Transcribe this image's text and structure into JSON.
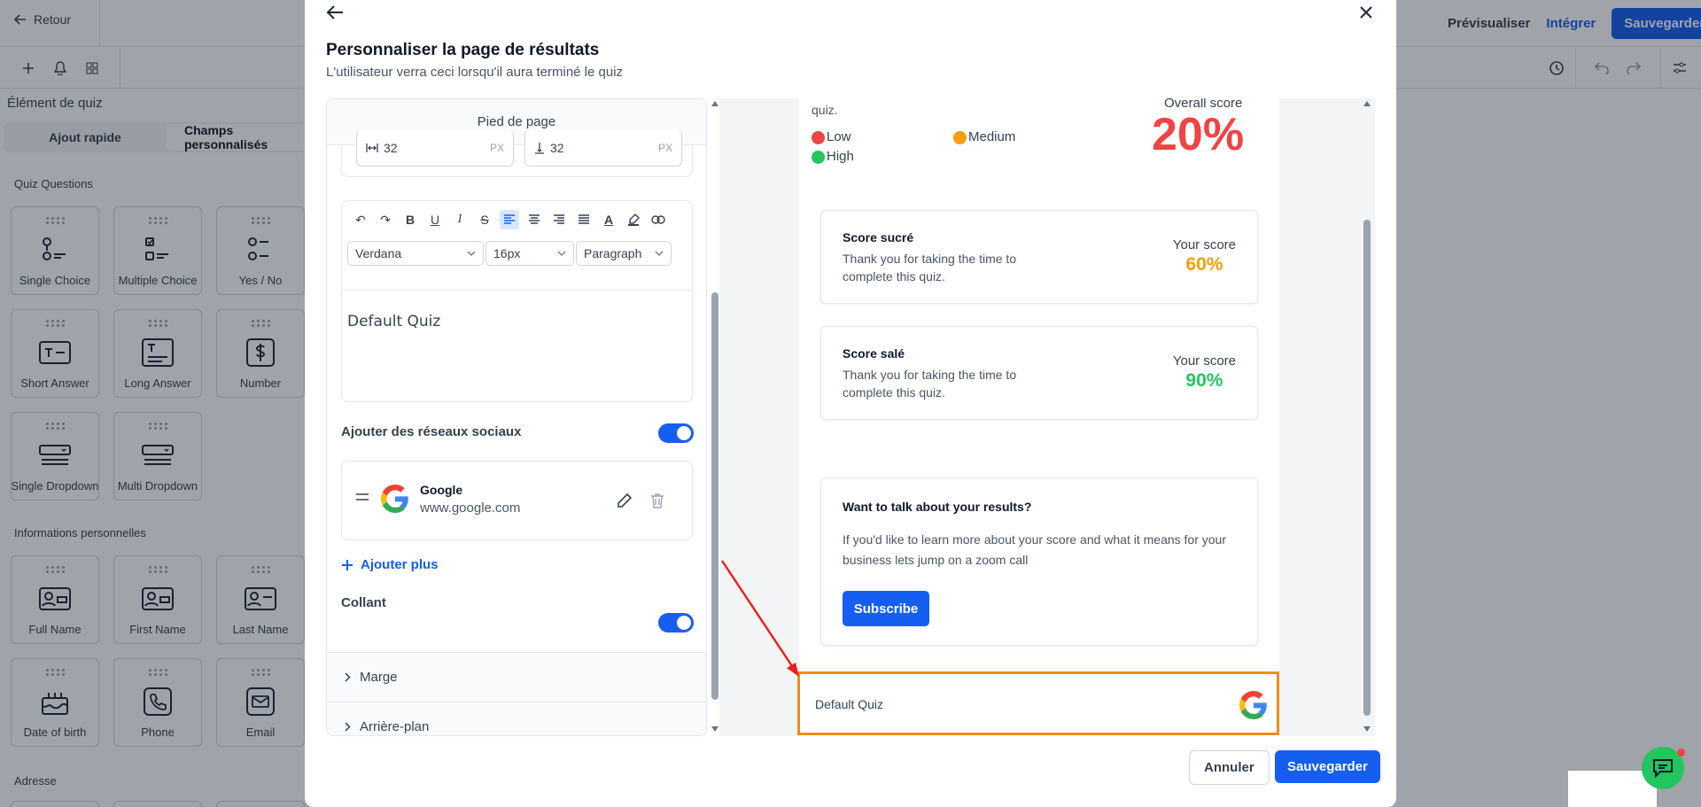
{
  "topbar": {
    "back_label": "Retour",
    "preview_label": "Prévisualiser",
    "embed_label": "Intégrer",
    "save_label": "Sauvegarder"
  },
  "left_panel": {
    "title": "Élément de quiz",
    "tabs": [
      "Ajout rapide",
      "Champs personnalisés"
    ],
    "sections": [
      {
        "heading": "Quiz Questions",
        "items": [
          "Single Choice",
          "Multiple Choice",
          "Yes / No",
          "Short Answer",
          "Long Answer",
          "Number",
          "Single Dropdown",
          "Multi Dropdown"
        ]
      },
      {
        "heading": "Informations personnelles",
        "items": [
          "Full Name",
          "First Name",
          "Last Name",
          "Date of birth",
          "Phone",
          "Email"
        ]
      },
      {
        "heading": "Adresse",
        "items": []
      }
    ]
  },
  "modal": {
    "title": "Personnaliser la page de résultats",
    "subtitle": "L'utilisateur verra ceci lorsqu'il aura terminé le quiz",
    "cancel_label": "Annuler",
    "save_label": "Sauvegarder",
    "editor": {
      "section_title": "Pied de page",
      "width_value": "32",
      "height_value": "32",
      "unit": "PX",
      "font_family": "Verdana",
      "font_size": "16px",
      "block_type": "Paragraph",
      "content_text": "Default Quiz",
      "social_label": "Ajouter des réseaux sociaux",
      "social_enabled": true,
      "social_items": [
        {
          "name": "Google",
          "url": "www.google.com"
        }
      ],
      "add_more_label": "Ajouter plus",
      "sticky_label": "Collant",
      "sticky_enabled": true,
      "accordions": [
        "Marge",
        "Arrière-plan"
      ]
    },
    "preview": {
      "intro_fragment": "quiz.",
      "legend": [
        {
          "label": "Low",
          "color": "#ef4444"
        },
        {
          "label": "Medium",
          "color": "#f59e0b"
        },
        {
          "label": "High",
          "color": "#22c55e"
        }
      ],
      "overall_label": "Overall score",
      "overall_value": "20%",
      "overall_color": "#ef4444",
      "scores": [
        {
          "title": "Score sucré",
          "desc": "Thank you for taking the time to complete this quiz.",
          "your_label": "Your score",
          "value": "60%",
          "color": "#f59e0b"
        },
        {
          "title": "Score salé",
          "desc": "Thank you for taking the time to complete this quiz.",
          "your_label": "Your score",
          "value": "90%",
          "color": "#22c55e"
        }
      ],
      "cta": {
        "title": "Want to talk about your results?",
        "body": "If you'd like to learn more about your score and what it means for your business lets jump on a zoom call",
        "button": "Subscribe"
      },
      "footer_text": "Default Quiz",
      "highlight_color": "#f28c16"
    }
  }
}
